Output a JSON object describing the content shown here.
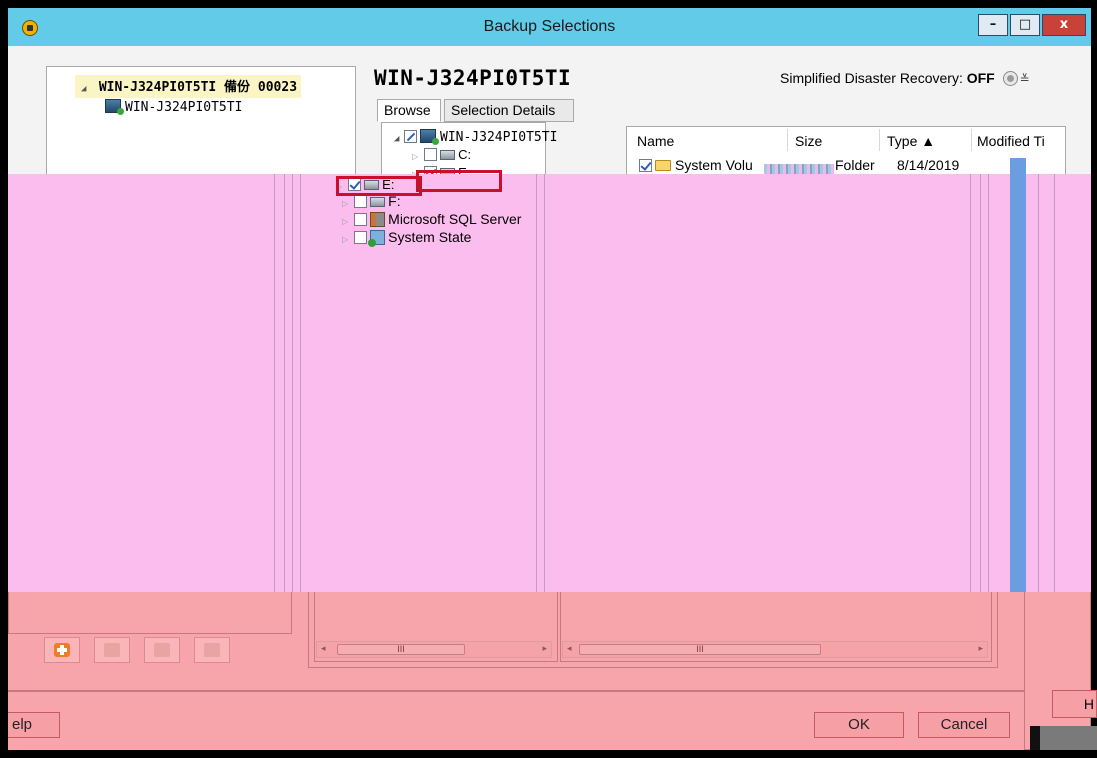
{
  "window": {
    "title": "Backup Selections",
    "buttons": {
      "minimize": "–",
      "maximize": "□",
      "close": "x"
    }
  },
  "left_tree": {
    "root_label": "WIN-J324PI0T5TI 備份 00023",
    "child_label": "WIN-J324PI0T5TI"
  },
  "header": {
    "title": "WIN-J324PI0T5TI",
    "sdr_label": "Simplified Disaster Recovery: ",
    "sdr_value": "OFF"
  },
  "tabs": {
    "browse": "Browse",
    "selection_details": "Selection Details"
  },
  "browse_tree": {
    "root_label": "WIN-J324PI0T5TI",
    "items": [
      {
        "label": "C:",
        "checked": false
      },
      {
        "label": "E:",
        "checked": true
      },
      {
        "label": "F:",
        "checked": false
      },
      {
        "label": "Microsoft SQL Server",
        "checked": false
      },
      {
        "label": "System State",
        "checked": false
      }
    ]
  },
  "file_list": {
    "columns": [
      "Name",
      "Size",
      "Type ▲",
      "Modified Ti"
    ],
    "rows": [
      {
        "name": "System Volu",
        "type": "Folder",
        "modified": "8/14/2019"
      }
    ]
  },
  "scrollbar": {
    "thumb_grip": "III"
  },
  "footer": {
    "help": "elp",
    "ok": "OK",
    "cancel": "Cancel",
    "right_fragment": "H"
  },
  "colors": {
    "titlebar": "#62cbe8",
    "highlight_box": "#c8102e",
    "corrupt_pink": "#fbbdee",
    "corrupt_salmon": "#f7a4aa",
    "add_button_accent": "#f47a2a"
  }
}
